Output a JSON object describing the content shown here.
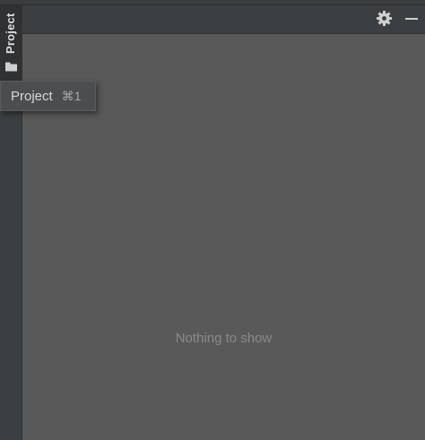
{
  "sidebar": {
    "project_tab_label": "Project",
    "project_tab_icon": "folder-icon"
  },
  "tooltip": {
    "title": "Project",
    "shortcut": "⌘1"
  },
  "header": {
    "settings_icon": "gear-icon",
    "minimize_icon": "minimize-icon"
  },
  "content": {
    "empty_message": "Nothing to show"
  },
  "colors": {
    "background": "#3c3f41",
    "content_background": "#595959",
    "stripe_active": "#2f3133",
    "text_primary": "#dcdcdc",
    "text_muted": "#8a8a8a"
  }
}
